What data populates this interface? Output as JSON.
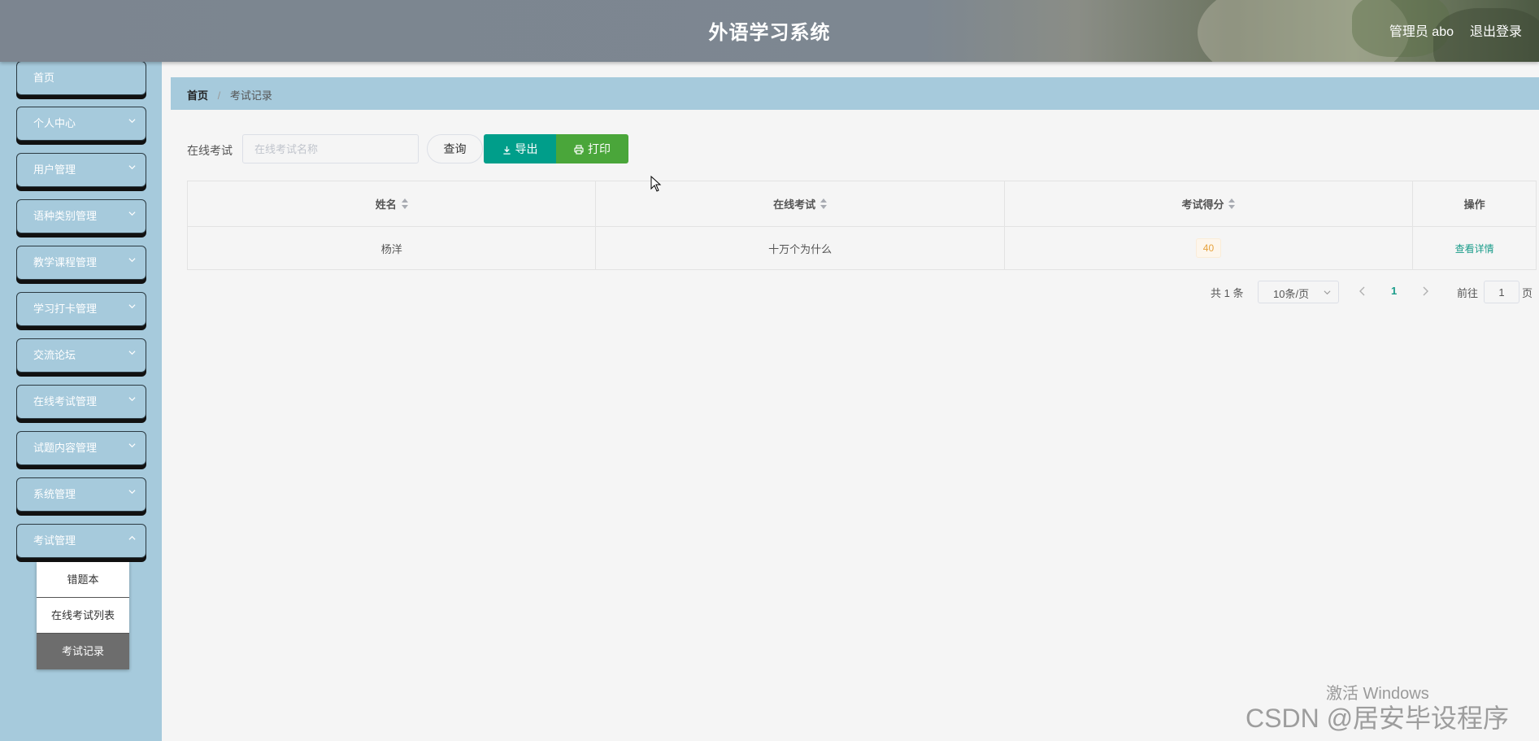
{
  "header": {
    "title": "外语学习系统",
    "user": "管理员 abo",
    "logout": "退出登录"
  },
  "sidebar": {
    "items": [
      {
        "label": "首页"
      },
      {
        "label": "个人中心"
      },
      {
        "label": "用户管理"
      },
      {
        "label": "语种类别管理"
      },
      {
        "label": "教学课程管理"
      },
      {
        "label": "学习打卡管理"
      },
      {
        "label": "交流论坛"
      },
      {
        "label": "在线考试管理"
      },
      {
        "label": "试题内容管理"
      },
      {
        "label": "系统管理"
      },
      {
        "label": "考试管理"
      }
    ],
    "submenu": [
      {
        "label": "错题本"
      },
      {
        "label": "在线考试列表"
      },
      {
        "label": "考试记录"
      }
    ]
  },
  "breadcrumb": {
    "home": "首页",
    "current": "考试记录"
  },
  "search": {
    "label": "在线考试",
    "placeholder": "在线考试名称",
    "query": "查询",
    "export": "导出",
    "print": "打印"
  },
  "table": {
    "headers": [
      "姓名",
      "在线考试",
      "考试得分",
      "操作"
    ],
    "rows": [
      {
        "name": "杨洋",
        "exam": "十万个为什么",
        "score": "40",
        "action": "查看详情"
      }
    ]
  },
  "pagination": {
    "total": "共 1 条",
    "page_size": "10条/页",
    "current": "1",
    "goto": "前往",
    "page_value": "1",
    "page_suffix": "页"
  },
  "overlays": {
    "activate": "激活 Windows",
    "watermark": "CSDN @居安毕设程序"
  },
  "colors": {
    "sidebar": "#a6cadc",
    "export_button": "#009e8a",
    "print_button": "#4aa63a",
    "active_submenu": "#6d6d6d",
    "link": "#1a9c8a"
  }
}
